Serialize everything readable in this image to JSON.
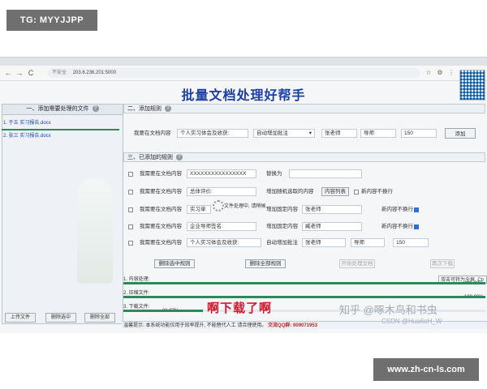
{
  "watermarks": {
    "top": "TG: MYYJJPP",
    "bottom": "www.zh-cn-ls.com"
  },
  "browser": {
    "security": "不安全",
    "url": "203.6.236.201:5000",
    "nav": {
      "back": "←",
      "forward": "→",
      "reload": "C",
      "info": "⚠"
    }
  },
  "app": {
    "title": "批量文档处理好帮手",
    "left_panel": {
      "header": "一、添加需要处理的文件",
      "files": [
        "1. 于五 实习报告.docx",
        "2. 张三 实习报告.docx"
      ],
      "buttons": [
        "上传文件",
        "删除选中",
        "删除全部"
      ]
    },
    "section2": {
      "header": "二、添加规则",
      "field_label": "我要在文档内容",
      "target_value": "个人实习体会及收获:",
      "action_select": "自动增加批注",
      "teacher_value": "张老师",
      "role_value": "导师",
      "number_value": "150",
      "add_button": "添加"
    },
    "section3": {
      "header": "三、已添加的规则",
      "rows": [
        {
          "label": "我需要在文档内容",
          "target": "XXXXXXXXXXXXXXXX",
          "action": "替换为",
          "value": "",
          "extra": ""
        },
        {
          "label": "我需要在文档内容",
          "target": "总体评价:",
          "action": "增加随机选取的内容",
          "value": "内容列表",
          "extra": "新内容不换行"
        },
        {
          "label": "我需要在文档内容",
          "target": "实习单",
          "action": "增加固定内容",
          "value": "张老师",
          "extra": "新内容不换行"
        },
        {
          "label": "我需要在文档内容",
          "target": "企业导师签名:",
          "action": "增加固定内容",
          "value": "臧老师",
          "extra": "新内容不换行"
        },
        {
          "label": "我需要在文档内容",
          "target": "个人实习体会及收获:",
          "action": "自动增加批注",
          "value": "张老师",
          "extra": "导师",
          "num": "150"
        }
      ],
      "loading_text": "文件处理中, 请稍候..."
    },
    "actions": {
      "delete_selected": "删除选中规则",
      "delete_all": "删除全部规则",
      "start": "开始处理文档",
      "download": "再次下载"
    },
    "progress": [
      {
        "label": "1. 内容处理:",
        "percent": "100.00%",
        "value": 1.0
      },
      {
        "label": "2. 压缩文件:",
        "percent": "100.00%",
        "value": 1.0
      },
      {
        "label": "3. 下载文件:",
        "percent": "21.97%",
        "value": 0.2197
      }
    ],
    "tooltip": "双击可转为全屏, Ctr",
    "status": {
      "prefix": "温馨提示: 本系统功能仅用于效率提升, 不能替代人工",
      "suffix": "请合理使用。",
      "contact": "交流QQ群: 909071953"
    }
  },
  "overlays": {
    "subtitle": "啊下载了啊",
    "zhihu": "知乎 @啄木鸟和书虫",
    "csdn": "CSDN @Hua6oH_W"
  },
  "colors": {
    "title_blue": "#1d3fa0",
    "progress_green": "#2c8a5a",
    "subtitle_red": "#d0192c"
  }
}
